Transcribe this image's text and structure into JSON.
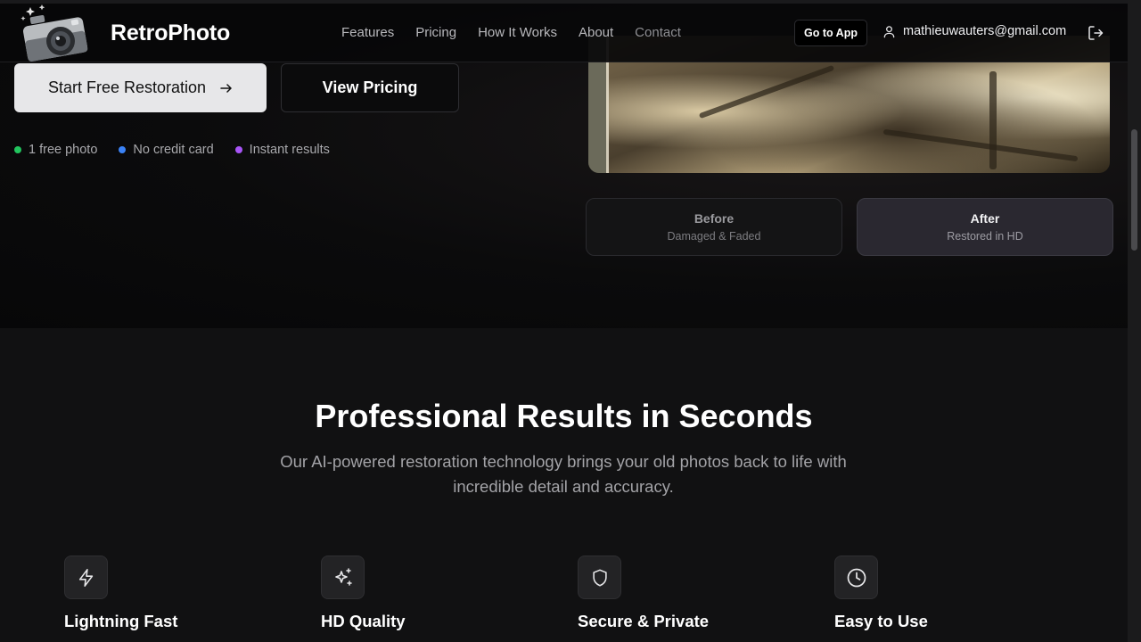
{
  "nav": {
    "brand": "RetroPhoto",
    "menu": [
      "Features",
      "Pricing",
      "How It Works",
      "About",
      "Contact"
    ],
    "go_app_label": "Go to App",
    "user_email": "mathieuwauters@gmail.com"
  },
  "hero": {
    "primary_button": "Start Free Restoration",
    "secondary_button": "View Pricing",
    "perks": [
      {
        "label": "1 free photo",
        "color": "#22c55e"
      },
      {
        "label": "No credit card",
        "color": "#3b82f6"
      },
      {
        "label": "Instant results",
        "color": "#a855f7"
      }
    ],
    "compare": {
      "before": {
        "title": "Before",
        "subtitle": "Damaged & Faded"
      },
      "after": {
        "title": "After",
        "subtitle": "Restored in HD"
      }
    }
  },
  "features": {
    "title": "Professional Results in Seconds",
    "subtitle": "Our AI-powered restoration technology brings your old photos back to life with incredible detail and accuracy.",
    "items": [
      {
        "name": "Lightning Fast",
        "icon": "lightning-icon"
      },
      {
        "name": "HD Quality",
        "icon": "sparkles-icon"
      },
      {
        "name": "Secure & Private",
        "icon": "shield-icon"
      },
      {
        "name": "Easy to Use",
        "icon": "clock-icon"
      }
    ]
  }
}
